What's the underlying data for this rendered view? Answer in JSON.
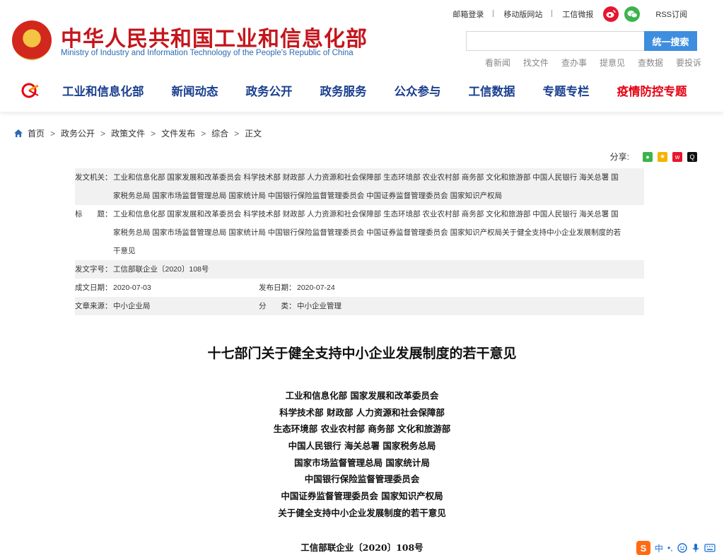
{
  "header": {
    "title": "中华人民共和国工业和信息化部",
    "subtitle": "Ministry of Industry and Information Technology of the People's Republic of China",
    "top_links": [
      "邮箱登录",
      "移动版网站",
      "工信微报",
      "RSS订阅"
    ],
    "search": {
      "placeholder": "",
      "button": "统一搜索"
    },
    "quick_links": [
      "看新闻",
      "找文件",
      "查办事",
      "提意见",
      "查数据",
      "要投诉"
    ]
  },
  "nav": {
    "items": [
      "工业和信息化部",
      "新闻动态",
      "政务公开",
      "政务服务",
      "公众参与",
      "工信数据",
      "专题专栏",
      "疫情防控专题"
    ]
  },
  "breadcrumb": [
    "首页",
    "政务公开",
    "政策文件",
    "文件发布",
    "综合",
    "正文"
  ],
  "share": {
    "label": "分享:",
    "icons": [
      "wechat-icon",
      "qzone-icon",
      "weibo-icon",
      "qq-icon"
    ]
  },
  "meta": {
    "issuer_label": "发文机关：",
    "issuer_line1": "工业和信息化部 国家发展和改革委员会 科学技术部 财政部 人力资源和社会保障部 生态环境部 农业农村部 商务部 文化和旅游部 中国人民银行 海关总署 国",
    "issuer_line2": "家税务总局 国家市场监督管理总局 国家统计局 中国银行保险监督管理委员会 中国证券监督管理委员会 国家知识产权局",
    "title_label": "标　　题：",
    "title_line1": "工业和信息化部 国家发展和改革委员会 科学技术部 财政部 人力资源和社会保障部 生态环境部 农业农村部 商务部 文化和旅游部 中国人民银行 海关总署 国",
    "title_line2": "家税务总局 国家市场监督管理总局 国家统计局 中国银行保险监督管理委员会 中国证券监督管理委员会 国家知识产权局关于健全支持中小企业发展制度的若",
    "title_line3": "干意见",
    "docno_label": "发文字号：",
    "docno_value": "工信部联企业〔2020〕108号",
    "created_label": "成文日期：",
    "created_value": "2020-07-03",
    "published_label": "发布日期：",
    "published_value": "2020-07-24",
    "source_label": "文章来源：",
    "source_value": "中小企业局",
    "category_label": "分　　类：",
    "category_value": "中小企业管理"
  },
  "article": {
    "title": "十七部门关于健全支持中小企业发展制度的若干意见",
    "issuer_lines": [
      "工业和信息化部 国家发展和改革委员会",
      "科学技术部 财政部 人力资源和社会保障部",
      "生态环境部 农业农村部 商务部 文化和旅游部",
      "中国人民银行 海关总署 国家税务总局",
      "国家市场监督管理总局 国家统计局",
      "中国银行保险监督管理委员会",
      "中国证券监督管理委员会 国家知识产权局",
      "关于健全支持中小企业发展制度的若干意见"
    ],
    "doc_number": "工信部联企业〔2020〕108号"
  },
  "ime": {
    "logo": "S",
    "mode": "中",
    "punct": "•,",
    "icons": [
      "emoji-icon",
      "microphone-icon",
      "keyboard-icon"
    ]
  },
  "colors": {
    "brand_red": "#c4161c",
    "nav_blue": "#1a3f8f",
    "search_blue": "#3e8ee0",
    "meta_gray": "#f1f1f1"
  }
}
